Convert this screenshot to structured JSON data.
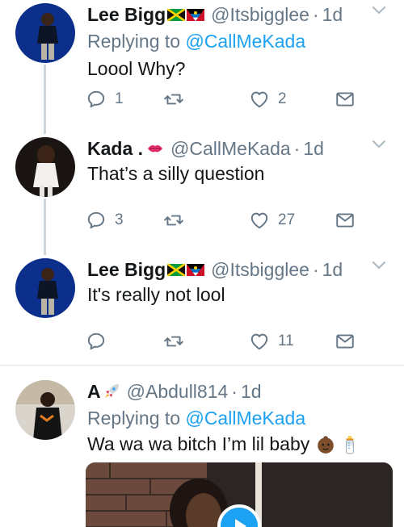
{
  "tweets": [
    {
      "name": "Lee Bigg",
      "handle": "@Itsbigglee",
      "sep": "·",
      "time": "1d",
      "replying_prefix": "Replying to ",
      "replying_to": "@CallMeKada",
      "text": "Loool Why?",
      "reply_count": "1",
      "retweet_count": "",
      "like_count": "2"
    },
    {
      "name": "Kada .",
      "handle": "@CallMeKada",
      "sep": "·",
      "time": "1d",
      "text": "That’s a silly question",
      "reply_count": "3",
      "retweet_count": "",
      "like_count": "27"
    },
    {
      "name": "Lee Bigg",
      "handle": "@Itsbigglee",
      "sep": "·",
      "time": "1d",
      "text": "It's really not lool",
      "reply_count": "",
      "retweet_count": "",
      "like_count": "11"
    },
    {
      "name": "A",
      "handle": "@Abdull814",
      "sep": "·",
      "time": "1d",
      "replying_prefix": "Replying to ",
      "replying_to": "@CallMeKada",
      "text": "Wa wa wa bitch I’m lil baby"
    }
  ],
  "icons": {
    "reply": "reply-icon",
    "retweet": "retweet-icon",
    "like": "heart-icon",
    "share": "share-icon",
    "more": "chevron-down-icon"
  },
  "colors": {
    "link": "#1da1f2",
    "muted": "#657786",
    "thread_line": "#ccd6dd",
    "divider": "#e1e8ed"
  }
}
